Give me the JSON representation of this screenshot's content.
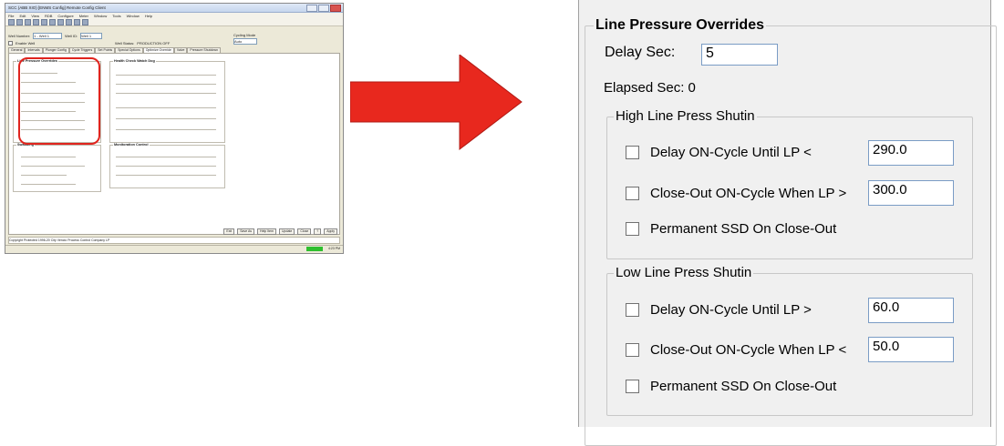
{
  "thumbnail": {
    "title": "SCC (ABB XIO)  [ENMS Config]  Remote Config Client",
    "menu": [
      "File",
      "Edit",
      "View",
      "RDB",
      "Configure",
      "Meter",
      "Window",
      "Tools",
      "Window",
      "Help"
    ],
    "well_number_label": "Well Number:",
    "well_number_value": "1 - Well 1",
    "well_id_label": "Well ID:",
    "well_id_value": "Well 1",
    "enable_well_label": "Enable Well",
    "well_status_label": "Well Status:",
    "well_status_value": "PRODUCTION OFF",
    "cycling_mode_label": "Cycling Mode",
    "cycling_mode_value": "Auto",
    "tabs": [
      "General",
      "Intervals",
      "Plunger Config",
      "Cycle Triggers",
      "Set Points",
      "Special Options",
      "Optimize Override",
      "Valve",
      "Pressure Shutdown"
    ],
    "groups": {
      "line_pressure": "Line Pressure Overrides",
      "health_check": "Health Check Watch Dog",
      "swabbing": "Swabbing",
      "monitor_control": "Monitoration Control"
    },
    "buttons": [
      "Exit",
      "Save As",
      "Help Item",
      "Update",
      "Close",
      "?",
      "Apply"
    ],
    "footer": "Copyright Protected 1996-20 City Vencio Process  Control Company LP",
    "status_right": "4:23 PM"
  },
  "panel": {
    "title": "Line Pressure Overrides",
    "delay_label": "Delay Sec:",
    "delay_value": "5",
    "elapsed_label": "Elapsed Sec: 0",
    "high": {
      "title": "High Line Press Shutin",
      "delay_label": "Delay ON-Cycle Until LP <",
      "delay_value": "290.0",
      "close_label": "Close-Out ON-Cycle When LP >",
      "close_value": "300.0",
      "ssd_label": "Permanent SSD On Close-Out"
    },
    "low": {
      "title": "Low Line Press Shutin",
      "delay_label": "Delay ON-Cycle Until LP >",
      "delay_value": "60.0",
      "close_label": "Close-Out ON-Cycle When LP <",
      "close_value": "50.0",
      "ssd_label": "Permanent SSD On Close-Out"
    }
  },
  "colors": {
    "arrow": "#e8281e",
    "highlight": "#e0241e",
    "panel_bg": "#f0f0f0",
    "textbox_border": "#7a9cc5"
  }
}
